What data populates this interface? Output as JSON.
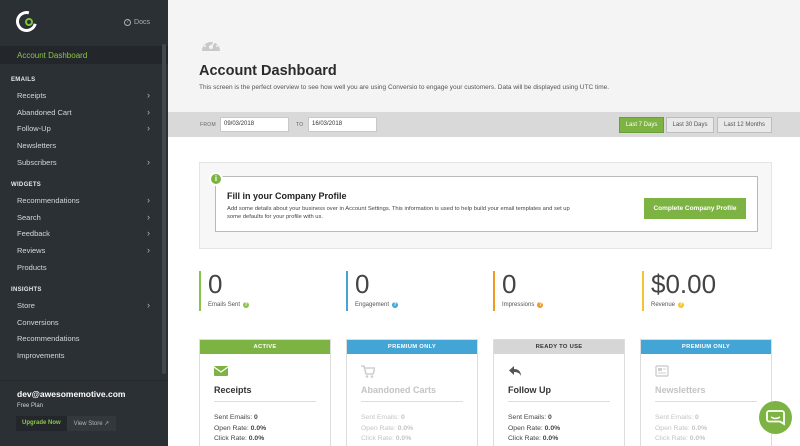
{
  "sidebar": {
    "docs_label": "Docs",
    "active_item": "Account Dashboard",
    "sections": [
      {
        "title": "EMAILS",
        "items": [
          {
            "label": "Receipts",
            "chevron": true
          },
          {
            "label": "Abandoned Cart",
            "chevron": true
          },
          {
            "label": "Follow-Up",
            "chevron": true
          },
          {
            "label": "Newsletters",
            "chevron": false
          },
          {
            "label": "Subscribers",
            "chevron": true
          }
        ]
      },
      {
        "title": "WIDGETS",
        "items": [
          {
            "label": "Recommendations",
            "chevron": true
          },
          {
            "label": "Search",
            "chevron": true
          },
          {
            "label": "Feedback",
            "chevron": true
          },
          {
            "label": "Reviews",
            "chevron": true
          },
          {
            "label": "Products",
            "chevron": false
          }
        ]
      },
      {
        "title": "INSIGHTS",
        "items": [
          {
            "label": "Store",
            "chevron": true
          },
          {
            "label": "Conversions",
            "chevron": false
          },
          {
            "label": "Recommendations",
            "chevron": false
          },
          {
            "label": "Improvements",
            "chevron": false
          }
        ]
      }
    ],
    "account": {
      "email": "dev@awesomemotive.com",
      "plan": "Free Plan",
      "upgrade_label": "Upgrade Now",
      "store_label": "View Store"
    }
  },
  "header": {
    "title": "Account Dashboard",
    "description": "This screen is the perfect overview to see how well you are using Conversio to engage your customers. Data will be displayed using UTC time."
  },
  "filters": {
    "from_label": "FROM",
    "from_value": "09/03/2018",
    "to_label": "TO",
    "to_value": "16/03/2018",
    "ranges": [
      "Last 7 Days",
      "Last 30 Days",
      "Last 12 Months"
    ],
    "active_range": "Last 7 Days"
  },
  "profile": {
    "title": "Fill in your Company Profile",
    "text": "Add some details about your business over in Account Settings. This information is used to help build your email templates and set up some defaults for your profile with us.",
    "button_label": "Complete Company Profile"
  },
  "stats": [
    {
      "value": "0",
      "label": "Emails Sent",
      "color": "#8bc34a"
    },
    {
      "value": "0",
      "label": "Engagement",
      "color": "#42a5d5"
    },
    {
      "value": "0",
      "label": "Impressions",
      "color": "#f09a26"
    },
    {
      "value": "$0.00",
      "label": "Revenue",
      "color": "#f4c430"
    }
  ],
  "features": [
    {
      "status": "ACTIVE",
      "status_color": "#7cb342",
      "name": "Receipts",
      "icon": "envelope-icon",
      "dim": false,
      "sent_label": "Sent Emails:",
      "sent": "0",
      "open_label": "Open Rate:",
      "open": "0.0%",
      "click_label": "Click Rate:",
      "click": "0.0%"
    },
    {
      "status": "PREMIUM ONLY",
      "status_color": "#42a5d5",
      "name": "Abandoned Carts",
      "icon": "cart-icon",
      "dim": true,
      "sent_label": "Sent Emails:",
      "sent": "0",
      "open_label": "Open Rate:",
      "open": "0.0%",
      "click_label": "Click Rate:",
      "click": "0.0%"
    },
    {
      "status": "READY TO USE",
      "status_color": "#d6d6d6",
      "name": "Follow Up",
      "icon": "reply-icon",
      "dim": false,
      "sent_label": "Sent Emails:",
      "sent": "0",
      "open_label": "Open Rate:",
      "open": "0.0%",
      "click_label": "Click Rate:",
      "click": "0.0%"
    },
    {
      "status": "PREMIUM ONLY",
      "status_color": "#42a5d5",
      "name": "Newsletters",
      "icon": "newspaper-icon",
      "dim": true,
      "sent_label": "Sent Emails:",
      "sent": "0",
      "open_label": "Open Rate:",
      "open": "0.0%",
      "click_label": "Click Rate:",
      "click": "0.0%"
    }
  ]
}
